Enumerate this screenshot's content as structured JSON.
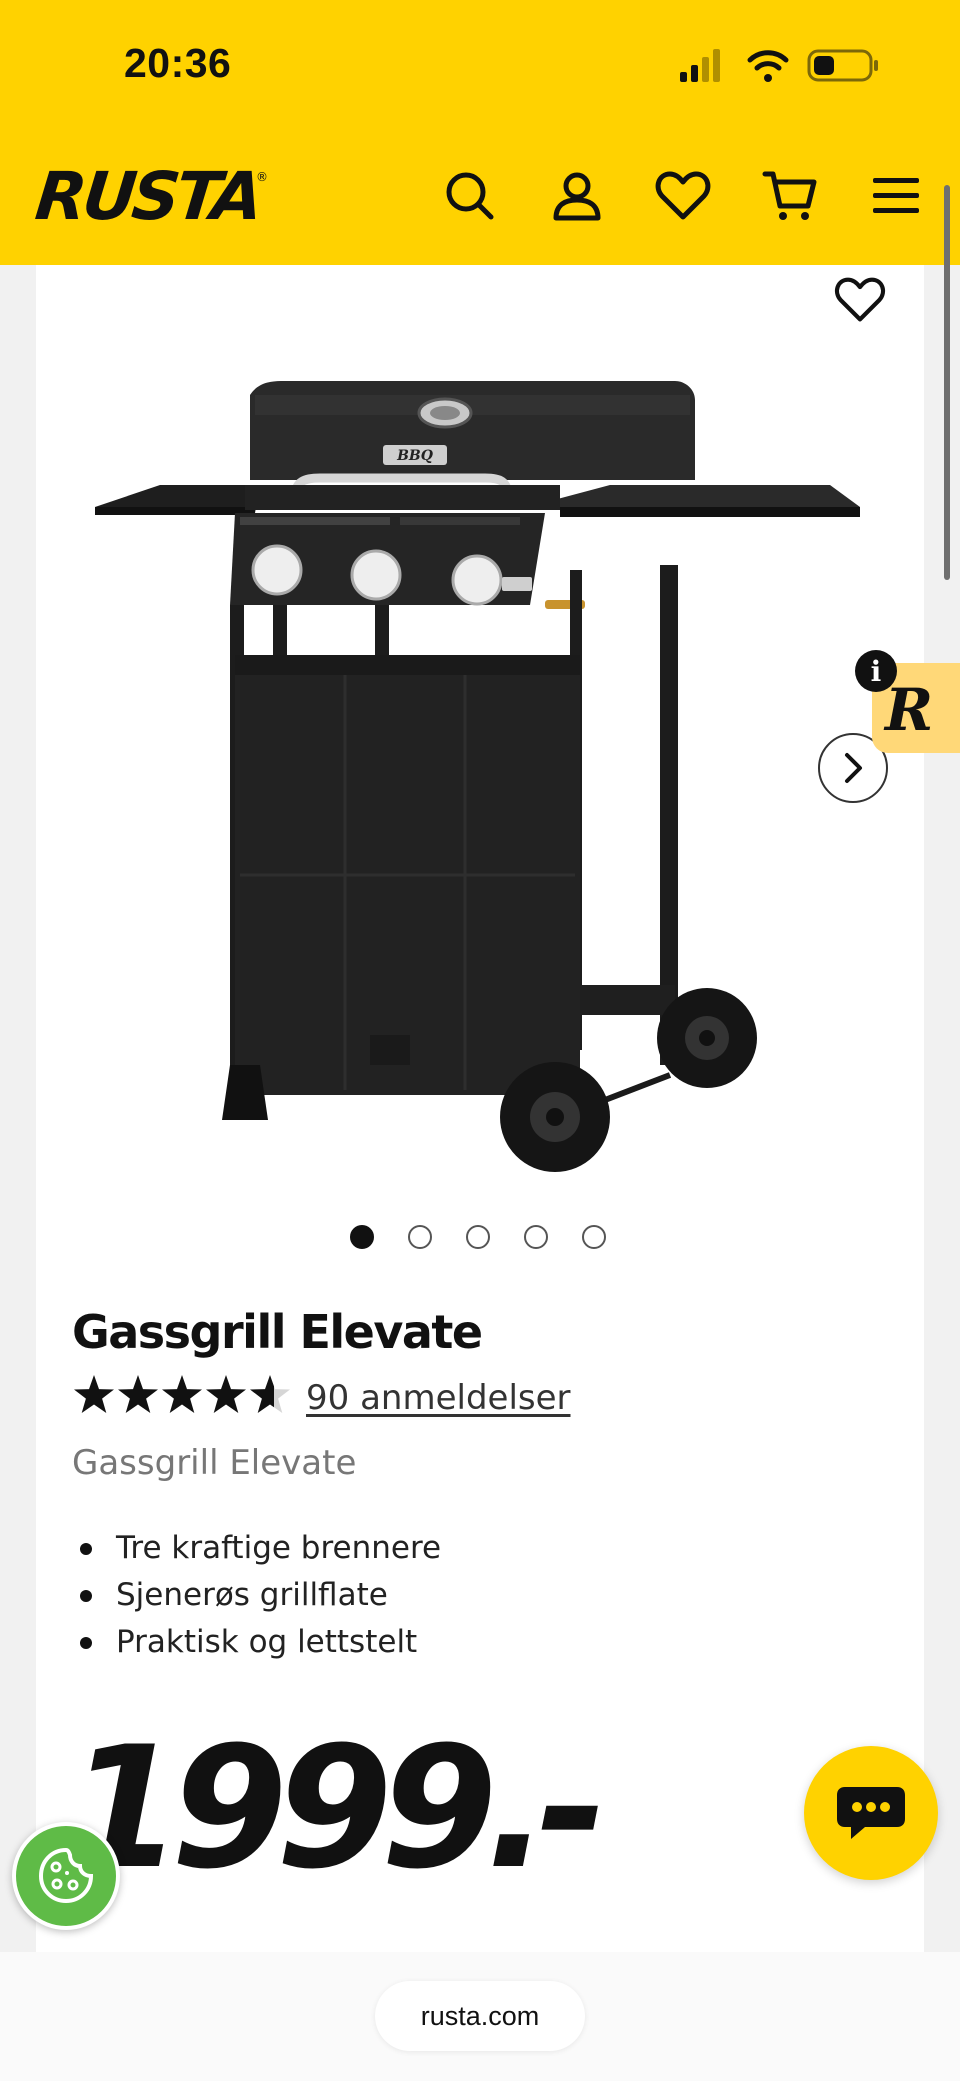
{
  "status_bar": {
    "time": "20:36"
  },
  "header": {
    "logo": "RUSTA",
    "logo_mark": "®",
    "icons": [
      "search-icon",
      "account-icon",
      "heart-icon",
      "cart-icon",
      "menu-icon"
    ]
  },
  "carousel": {
    "total_images": 5,
    "active_index": 0
  },
  "product": {
    "title": "Gassgrill Elevate",
    "rating": 4.6,
    "reviews_label": "90 anmeldelser",
    "subtitle": "Gassgrill Elevate",
    "features": [
      "Tre kraftige brennere",
      "Sjenerøs grillflate",
      "Praktisk og lettstelt"
    ],
    "price": "1999.-"
  },
  "widgets": {
    "badge_letter": "R",
    "info_glyph": "i"
  },
  "browser": {
    "url": "rusta.com"
  },
  "colors": {
    "brand_yellow": "#ffd200",
    "badge_yellow": "#ffd878",
    "cookie_green": "#5fbb47"
  }
}
